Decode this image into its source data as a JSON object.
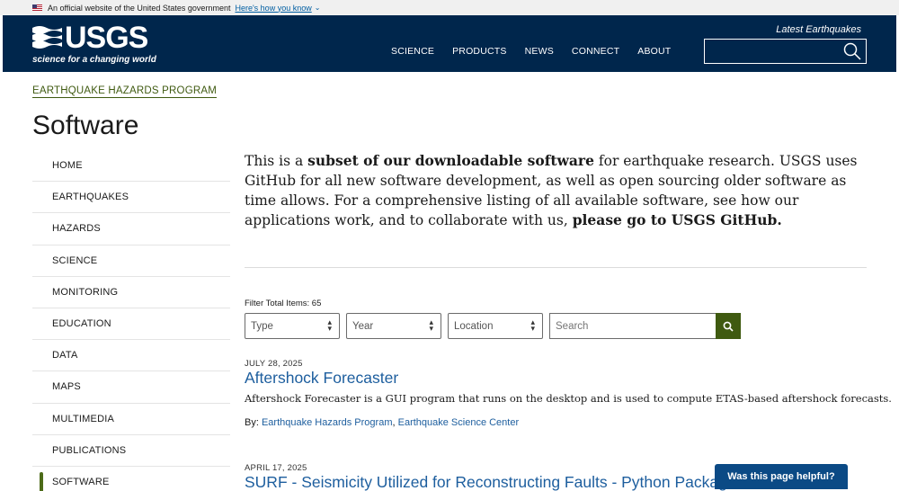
{
  "gov_banner": {
    "text": "An official website of the United States government",
    "link": "Here's how you know"
  },
  "header": {
    "logo_text": "USGS",
    "logo_tagline": "science for a changing world",
    "nav": [
      "SCIENCE",
      "PRODUCTS",
      "NEWS",
      "CONNECT",
      "ABOUT"
    ],
    "latest_earthquakes": "Latest Earthquakes",
    "search_placeholder": ""
  },
  "breadcrumb": "EARTHQUAKE HAZARDS PROGRAM",
  "page_title": "Software",
  "sidebar": {
    "items": [
      "HOME",
      "EARTHQUAKES",
      "HAZARDS",
      "SCIENCE",
      "MONITORING",
      "EDUCATION",
      "DATA",
      "MAPS",
      "MULTIMEDIA",
      "PUBLICATIONS",
      "SOFTWARE"
    ],
    "active": "SOFTWARE"
  },
  "intro": {
    "part1": "This is a ",
    "bold1": "subset of our downloadable software",
    "part2": " for earthquake research. USGS uses GitHub for all new software development, as well as open sourcing older software as time allows. For a comprehensive listing of all available software, see how our applications work, and to collaborate with us, ",
    "bold2": "please go to USGS GitHub."
  },
  "filters": {
    "total_label": "Filter Total Items: 65",
    "type": "Type",
    "year": "Year",
    "location": "Location",
    "search_placeholder": "Search"
  },
  "items": [
    {
      "date": "JULY 28, 2025",
      "title": "Aftershock Forecaster",
      "description": "Aftershock Forecaster is a GUI program that runs on the desktop and is used to compute ETAS-based aftershock forecasts.",
      "by_label": "By:",
      "authors": [
        "Earthquake Hazards Program",
        "Earthquake Science Center"
      ]
    },
    {
      "date": "APRIL 17, 2025",
      "title": "SURF - Seismicity Utilized for Reconstructing Faults - Python Package"
    }
  ],
  "helpful_button": "Was this page helpful?",
  "colors": {
    "header_bg": "#00264c",
    "accent_green": "#3f5a10",
    "link_blue": "#1d5e9e",
    "helpful_bg": "#0b4a85"
  }
}
